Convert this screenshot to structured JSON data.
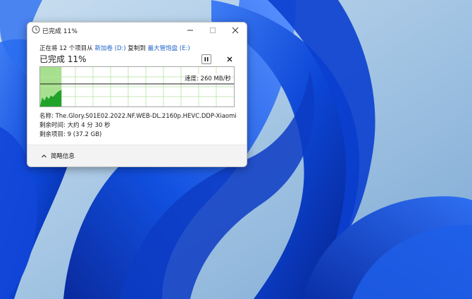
{
  "window": {
    "title": "已完成 11%"
  },
  "header": {
    "copy_prefix": "正在将 12 个项目从 ",
    "source": "新加卷 (D:)",
    "copy_mid": " 复制到 ",
    "destination": "最大管饱盘 (E:)",
    "percent_label": "已完成 11%"
  },
  "graph": {
    "speed_label": "速度: 260 MB/秒",
    "progress": 0.11,
    "fill_color": "#a6e08f",
    "area_color": "#21a32b",
    "grid_color": "#b4e3a1"
  },
  "details": {
    "name_label": "名称: ",
    "name_value": "The.Glory.S01E02.2022.NF.WEB-DL.2160p.HEVC.DDP-Xiaomi",
    "time_label": "剩余时间: ",
    "time_value": "大约 4 分 30 秒",
    "items_label": "剩余项目: ",
    "items_value": "9 (37.2 GB)"
  },
  "footer": {
    "less_info": "简略信息"
  },
  "colors": {
    "link": "#1d63c7",
    "wallpaper_base": "#9ec3e4",
    "wallpaper_accent": "#0a3ed0"
  },
  "icons": {
    "title": "clock-icon",
    "pause": "pause-icon",
    "stop": "close-icon",
    "expand": "chevron-up-icon"
  }
}
